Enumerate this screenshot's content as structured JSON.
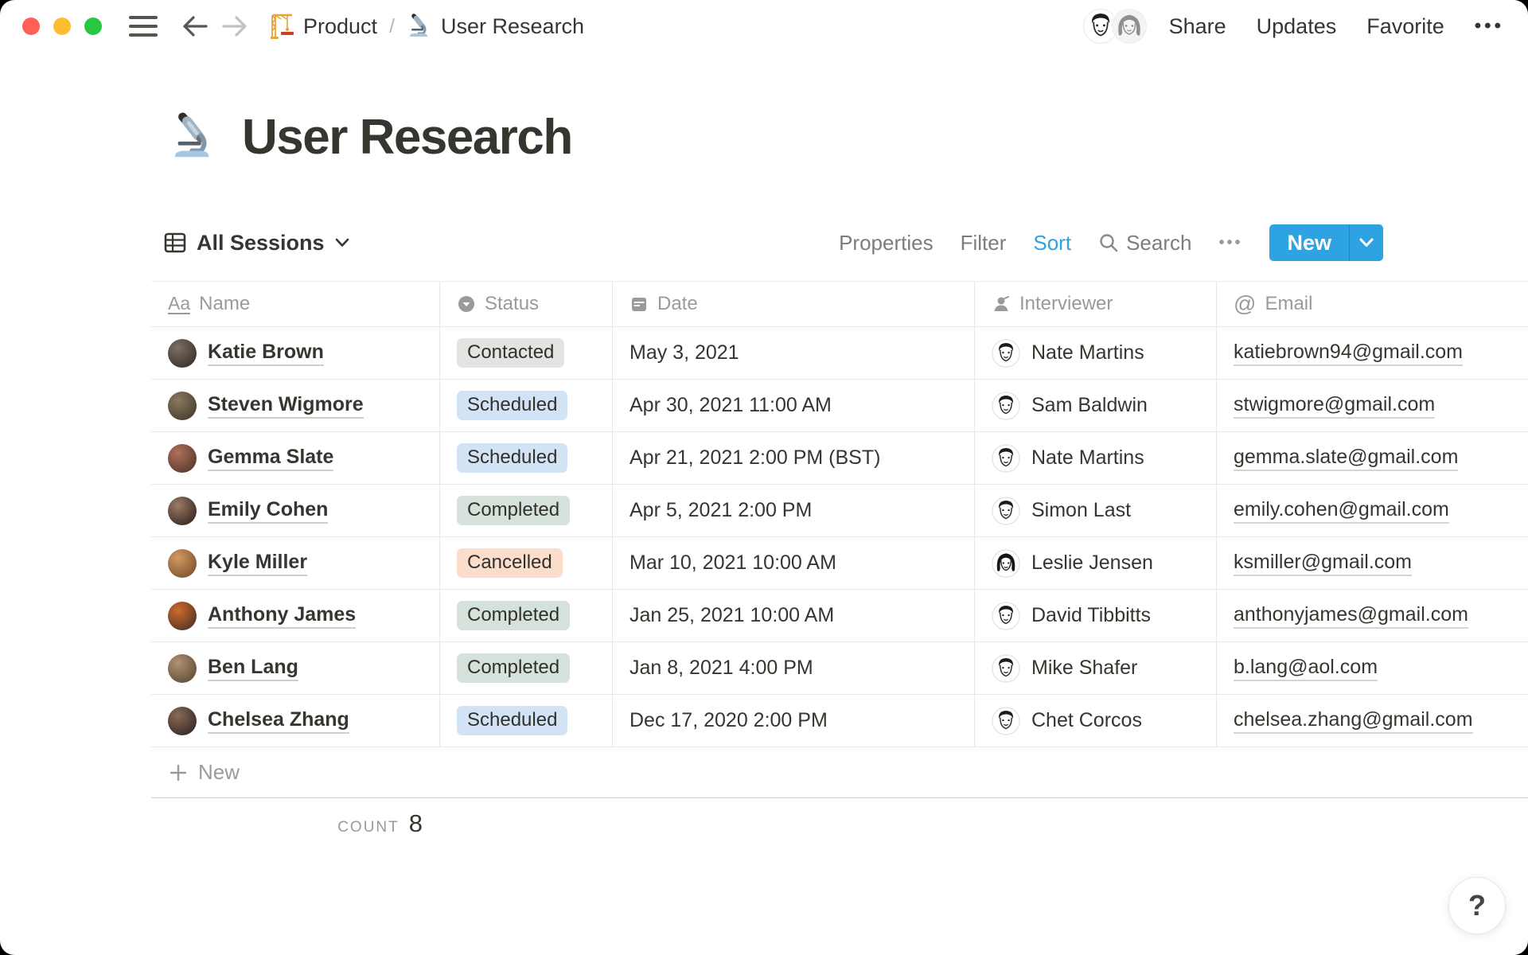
{
  "topbar": {
    "breadcrumb": {
      "items": [
        {
          "icon": "crane",
          "label": "Product"
        },
        {
          "icon": "microscope",
          "label": "User Research"
        }
      ],
      "separator": "/"
    },
    "actions": {
      "share": "Share",
      "updates": "Updates",
      "favorite": "Favorite"
    },
    "more_icon": "•••"
  },
  "page": {
    "icon": "microscope",
    "title": "User Research"
  },
  "toolbar": {
    "view_label": "All Sessions",
    "properties": "Properties",
    "filter": "Filter",
    "sort": "Sort",
    "search": "Search",
    "more_icon": "•••",
    "new_label": "New",
    "accent_color": "#2EA3E2"
  },
  "table": {
    "columns": [
      {
        "icon": "text-icon",
        "label": "Name"
      },
      {
        "icon": "select-icon",
        "label": "Status"
      },
      {
        "icon": "calendar-icon",
        "label": "Date"
      },
      {
        "icon": "person-icon",
        "label": "Interviewer"
      },
      {
        "icon": "at-icon",
        "label": "Email"
      }
    ],
    "rows": [
      {
        "name": "Katie Brown",
        "status": "Contacted",
        "date": "May 3, 2021",
        "interviewer": "Nate Martins",
        "email": "katiebrown94@gmail.com",
        "avatar_colors": [
          "#7d6e63",
          "#2e2620"
        ],
        "face": "m"
      },
      {
        "name": "Steven Wigmore",
        "status": "Scheduled",
        "date": "Apr 30, 2021 11:00 AM",
        "interviewer": "Sam Baldwin",
        "email": "stwigmore@gmail.com",
        "avatar_colors": [
          "#8c7a5e",
          "#3a3128"
        ],
        "face": "m"
      },
      {
        "name": "Gemma Slate",
        "status": "Scheduled",
        "date": "Apr 21, 2021 2:00 PM (BST)",
        "interviewer": "Nate Martins",
        "email": "gemma.slate@gmail.com",
        "avatar_colors": [
          "#b0705a",
          "#472e26"
        ],
        "face": "m"
      },
      {
        "name": "Emily Cohen",
        "status": "Completed",
        "date": "Apr 5, 2021 2:00 PM",
        "interviewer": "Simon Last",
        "email": "emily.cohen@gmail.com",
        "avatar_colors": [
          "#9c7a66",
          "#241a16"
        ],
        "face": "m"
      },
      {
        "name": "Kyle Miller",
        "status": "Cancelled",
        "date": "Mar 10, 2021 10:00 AM",
        "interviewer": "Leslie Jensen",
        "email": "ksmiller@gmail.com",
        "avatar_colors": [
          "#d29a62",
          "#6e4526"
        ],
        "face": "f"
      },
      {
        "name": "Anthony James",
        "status": "Completed",
        "date": "Jan 25, 2021 10:00 AM",
        "interviewer": "David Tibbitts",
        "email": "anthonyjames@gmail.com",
        "avatar_colors": [
          "#d06a2c",
          "#3a2a22"
        ],
        "face": "m"
      },
      {
        "name": "Ben Lang",
        "status": "Completed",
        "date": "Jan 8, 2021 4:00 PM",
        "interviewer": "Mike Shafer",
        "email": "b.lang@aol.com",
        "avatar_colors": [
          "#b29274",
          "#51402f"
        ],
        "face": "m"
      },
      {
        "name": "Chelsea Zhang",
        "status": "Scheduled",
        "date": "Dec 17, 2020 2:00 PM",
        "interviewer": "Chet Corcos",
        "email": "chelsea.zhang@gmail.com",
        "avatar_colors": [
          "#8a6a58",
          "#241d1a"
        ],
        "face": "m"
      }
    ],
    "new_row_label": "New",
    "count_label": "COUNT",
    "count_value": "8"
  },
  "status_colors": {
    "Contacted": "#E4E3E1",
    "Scheduled": "#D3E3F6",
    "Completed": "#D5E2DC",
    "Cancelled": "#FBDDCC"
  },
  "help": {
    "label": "?"
  }
}
